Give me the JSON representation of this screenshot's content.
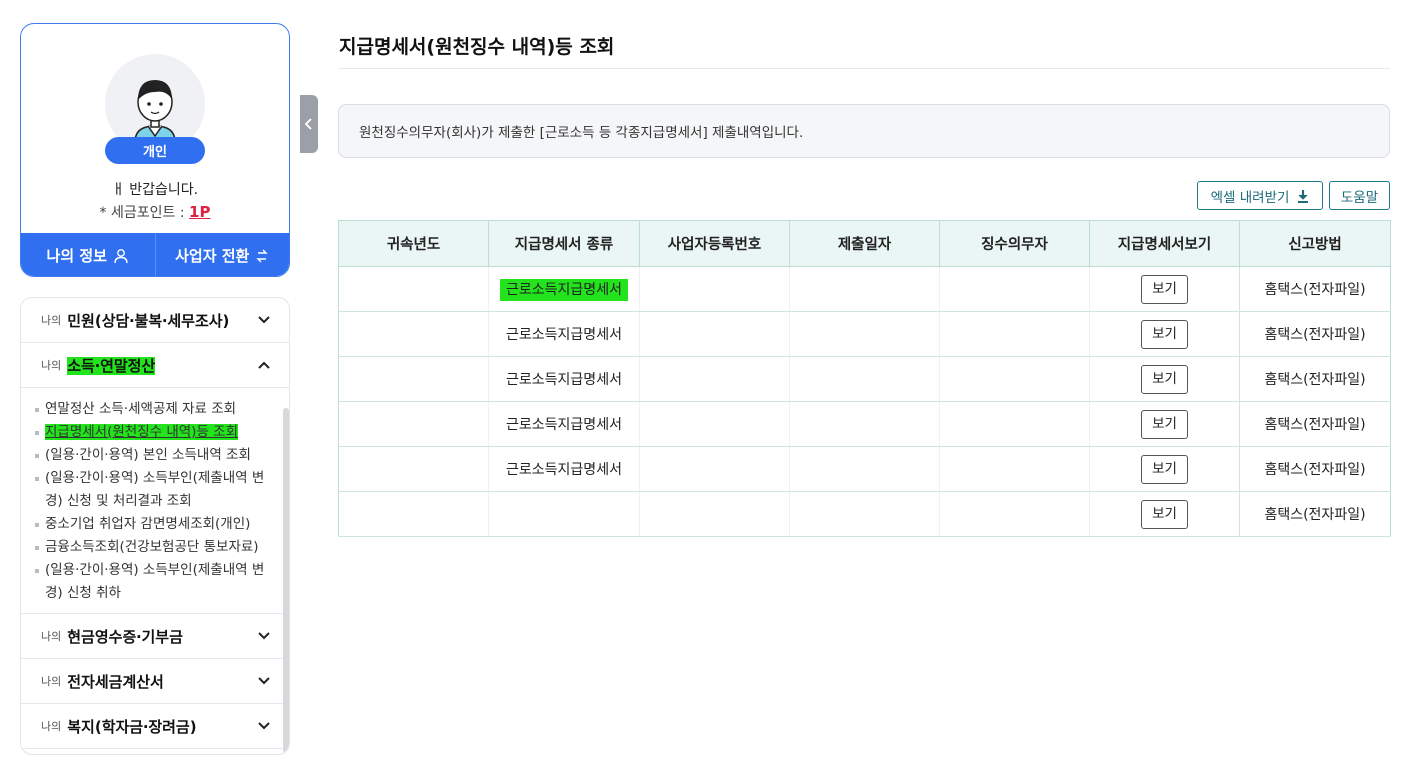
{
  "profile": {
    "type_badge": "개인",
    "greeting": "ㅐ 반갑습니다.",
    "points_label": "* 세금포인트 :",
    "points_value": "1P",
    "my_info_label": "나의 정보",
    "switch_business_label": "사업자 전환"
  },
  "menu": {
    "prefix": "나의",
    "sections": [
      {
        "title": "민원(상담‧불복‧세무조사)",
        "expanded": false
      },
      {
        "title": "소득‧연말정산",
        "expanded": true
      },
      {
        "title": "현금영수증‧기부금",
        "expanded": false
      },
      {
        "title": "전자세금계산서",
        "expanded": false
      },
      {
        "title": "복지(학자금‧장려금)",
        "expanded": false
      }
    ],
    "submenu": [
      {
        "label": "연말정산 소득‧세액공제 자료 조회"
      },
      {
        "label": "지급명세서(원천징수 내역)등 조회",
        "active": true
      },
      {
        "label": "(일용·간이·용역) 본인 소득내역 조회"
      },
      {
        "label": "(일용·간이·용역) 소득부인(제출내역 변경) 신청 및 처리결과 조회"
      },
      {
        "label": "중소기업 취업자 감면명세조회(개인)"
      },
      {
        "label": "금융소득조회(건강보험공단 통보자료)"
      },
      {
        "label": "(일용·간이·용역) 소득부인(제출내역 변경) 신청 취하"
      }
    ]
  },
  "main": {
    "title": "지급명세서(원천징수 내역)등 조회",
    "notice": "원천징수의무자(회사)가 제출한 [근로소득 등 각종지급명세서] 제출내역입니다.",
    "excel_label": "엑셀 내려받기",
    "help_label": "도움말",
    "table": {
      "headers": [
        "귀속년도",
        "지급명세서 종류",
        "사업자등록번호",
        "제출일자",
        "징수의무자",
        "지급명세서보기",
        "신고방법"
      ],
      "rows": [
        {
          "year": "",
          "kind": "근로소득지급명세서",
          "brn": "",
          "date": "",
          "payer": "",
          "view": "보기",
          "method": "홈택스(전자파일)",
          "highlight": true
        },
        {
          "year": "",
          "kind": "근로소득지급명세서",
          "brn": "",
          "date": "",
          "payer": "",
          "view": "보기",
          "method": "홈택스(전자파일)"
        },
        {
          "year": "",
          "kind": "근로소득지급명세서",
          "brn": "",
          "date": "",
          "payer": "",
          "view": "보기",
          "method": "홈택스(전자파일)"
        },
        {
          "year": "",
          "kind": "근로소득지급명세서",
          "brn": "",
          "date": "",
          "payer": "",
          "view": "보기",
          "method": "홈택스(전자파일)"
        },
        {
          "year": "",
          "kind": "근로소득지급명세서",
          "brn": "",
          "date": "",
          "payer": "",
          "view": "보기",
          "method": "홈택스(전자파일)"
        },
        {
          "year": "",
          "kind": "",
          "brn": "",
          "date": "",
          "payer": "",
          "view": "보기",
          "method": "홈택스(전자파일)"
        }
      ]
    }
  },
  "colors": {
    "accent": "#2f6ff0",
    "highlight": "#22e31c",
    "points": "#e02040",
    "table_header_bg": "#e9f6f4"
  }
}
